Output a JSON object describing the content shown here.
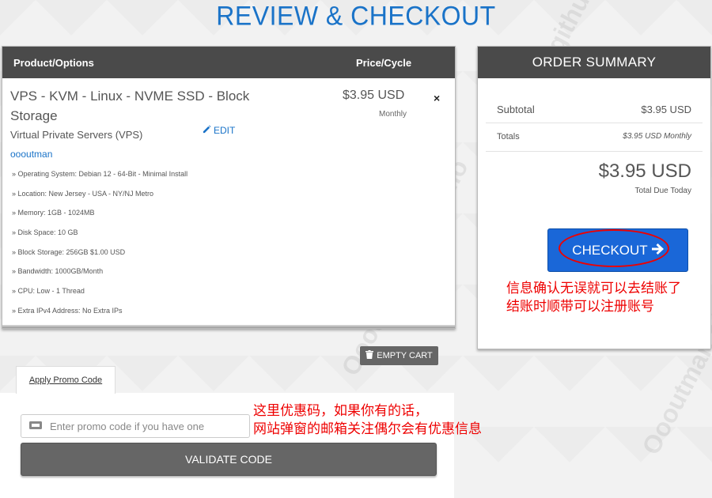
{
  "page": {
    "title": "REVIEW & CHECKOUT"
  },
  "cart": {
    "header_product": "Product/Options",
    "header_price": "Price/Cycle",
    "product_name": "VPS - KVM - Linux - NVME SSD - Block Storage",
    "product_group": "Virtual Private Servers (VPS)",
    "domain": "oooutman",
    "edit_label": "EDIT",
    "price": "$3.95 USD",
    "cycle": "Monthly",
    "remove_symbol": "×",
    "options": [
      "» Operating System: Debian 12 - 64-Bit - Minimal Install",
      "» Location: New Jersey - USA - NY/NJ Metro",
      "» Memory: 1GB - 1024MB",
      "» Disk Space: 10 GB",
      "» Block Storage: 256GB $1.00 USD",
      "» Bandwidth: 1000GB/Month",
      "» CPU: Low - 1 Thread",
      "» Extra IPv4 Address: No Extra IPs"
    ],
    "empty_cart_label": "EMPTY CART"
  },
  "promo": {
    "tab_label": "Apply Promo Code",
    "placeholder": "Enter promo code if you have one",
    "validate_label": "VALIDATE CODE"
  },
  "summary": {
    "title": "ORDER SUMMARY",
    "subtotal_label": "Subtotal",
    "subtotal_value": "$3.95 USD",
    "totals_label": "Totals",
    "totals_value": "$3.95 USD Monthly",
    "total_due": "$3.95 USD",
    "total_due_label": "Total Due Today",
    "checkout_label": "CHECKOUT"
  },
  "annotations": {
    "checkout_note_line1": "信息确认无误就可以去结账了",
    "checkout_note_line2": "结账时顺带可以注册账号",
    "promo_note_line1": "这里优惠码，如果你有的话，",
    "promo_note_line2": "网站弹窗的邮箱关注偶尔会有优惠信息"
  },
  "watermarks": [
    "Oooutman.github.io",
    "Oooutman.github.io",
    "Oooutman.github.io"
  ],
  "colors": {
    "accent": "#1a73c8",
    "header_bg": "#4a4a4a",
    "checkout_bg": "#1a67d8",
    "annotation": "#ee0000"
  }
}
